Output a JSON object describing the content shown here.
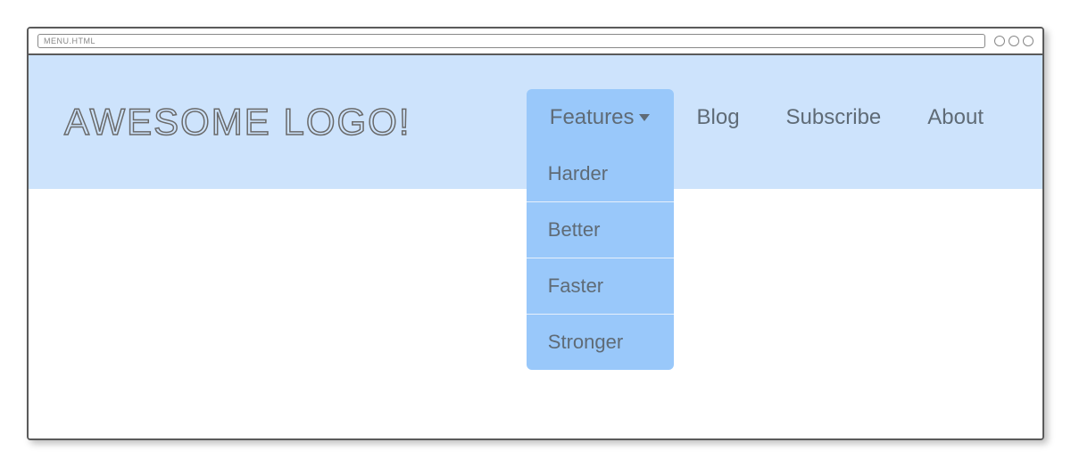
{
  "browser": {
    "url": "MENU.HTML"
  },
  "logo": "Awesome Logo!",
  "nav": {
    "features": {
      "label": "Features",
      "dropdown": [
        "Harder",
        "Better",
        "Faster",
        "Stronger"
      ]
    },
    "blog": "Blog",
    "subscribe": "Subscribe",
    "about": "About"
  }
}
